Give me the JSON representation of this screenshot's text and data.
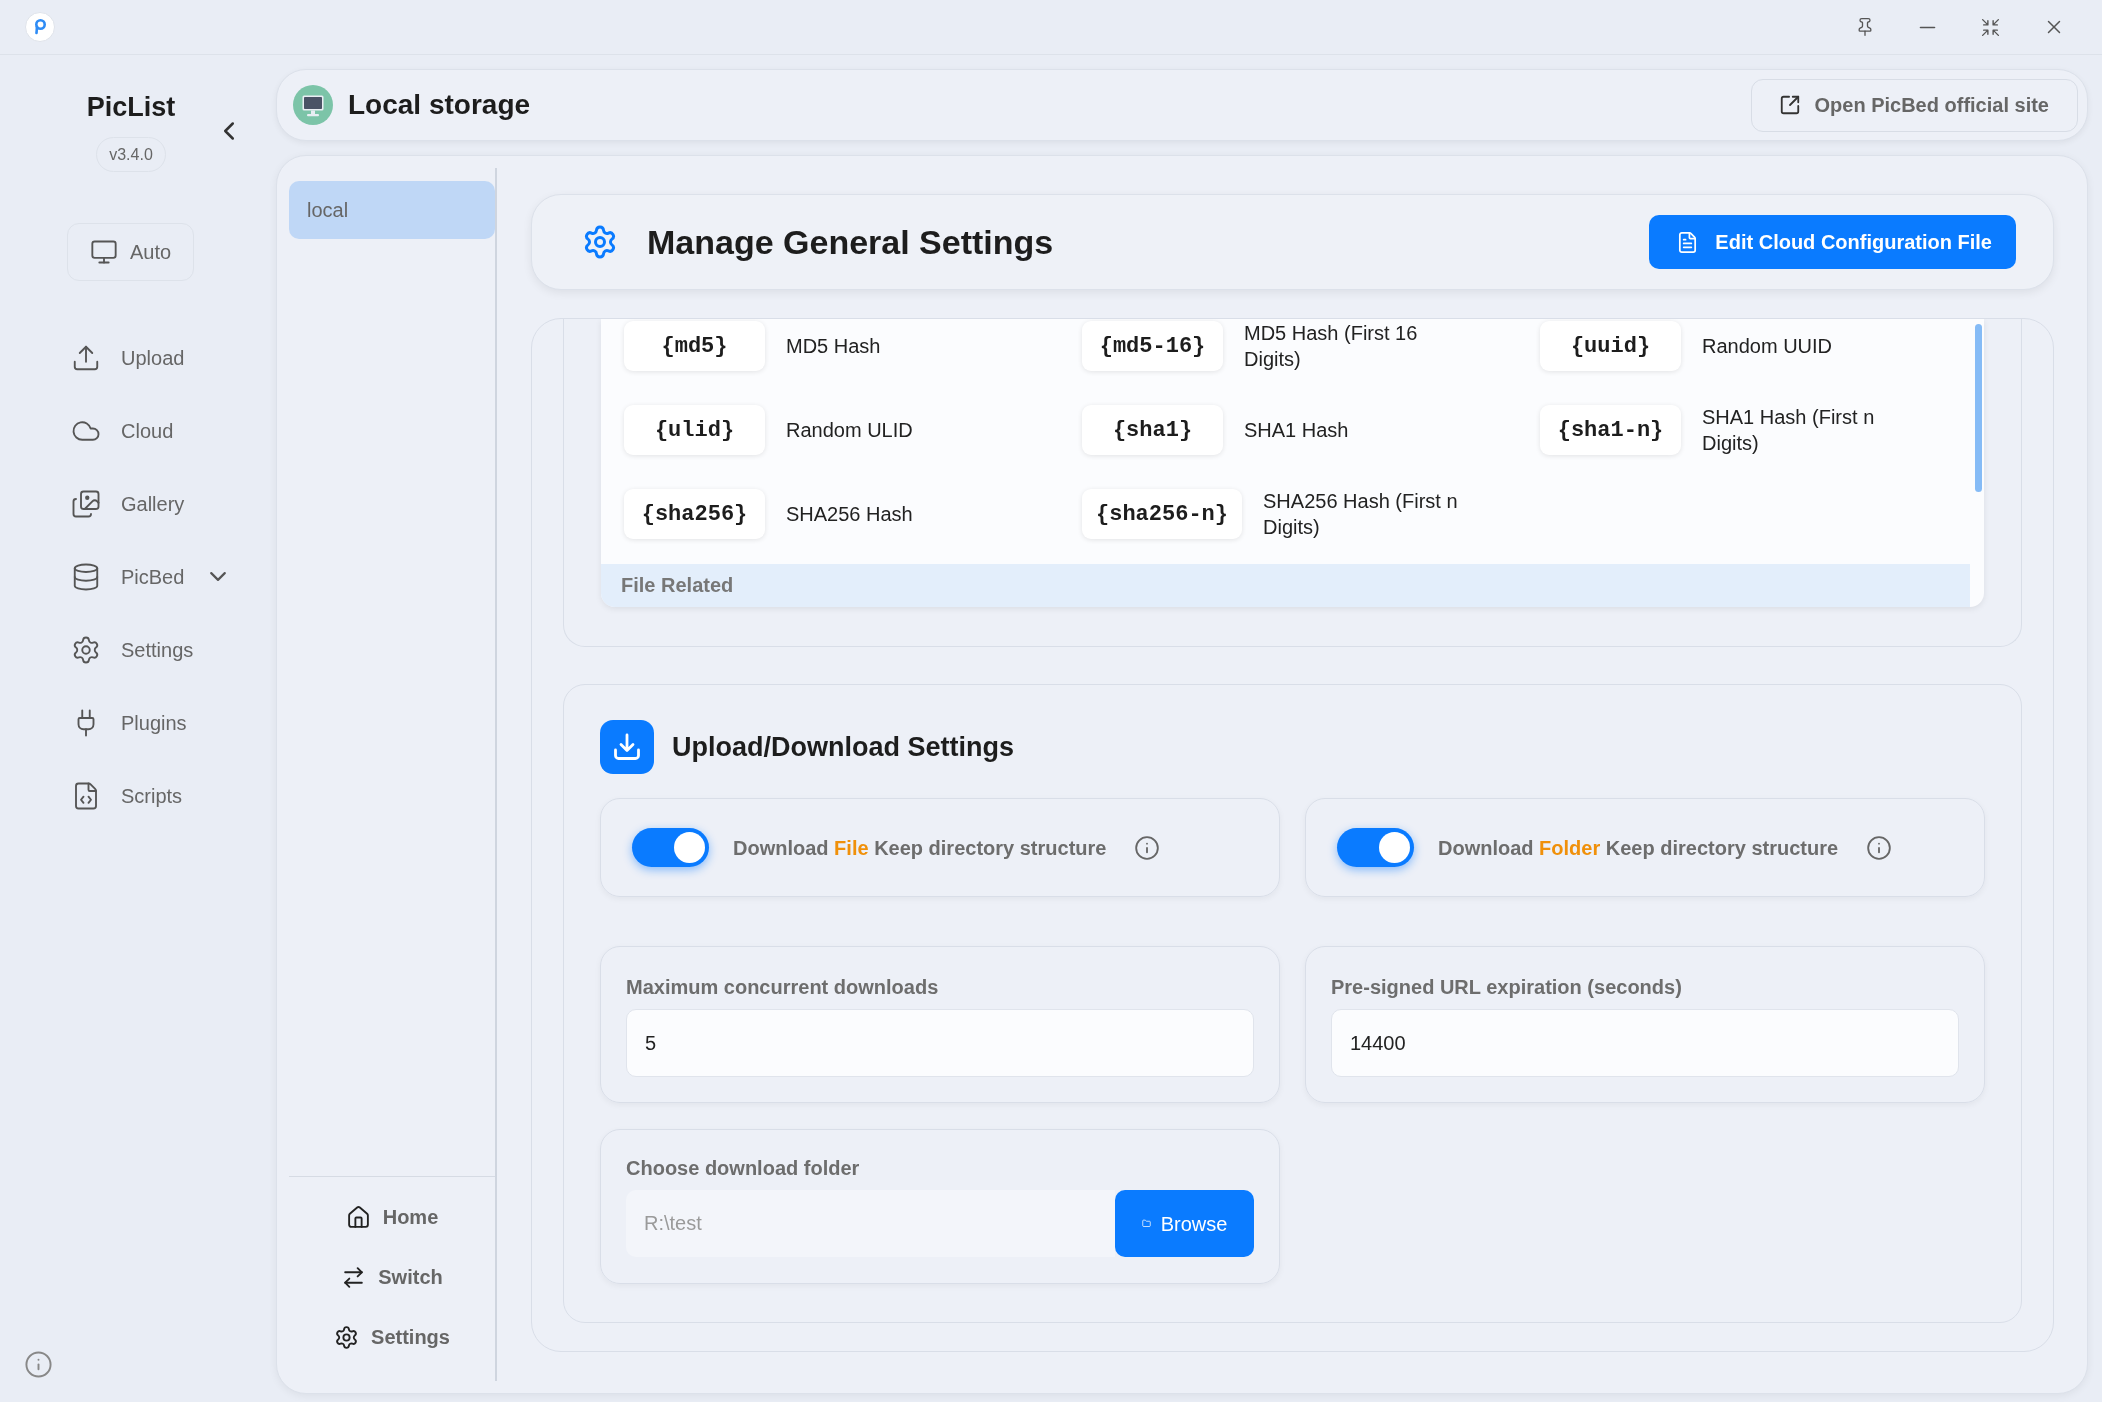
{
  "sidebar": {
    "app_name": "PicList",
    "version": "v3.4.0",
    "theme_button": {
      "label": "Auto"
    },
    "nav_items": [
      {
        "label": "Upload",
        "kind": "link"
      },
      {
        "label": "Cloud",
        "kind": "link"
      },
      {
        "label": "Gallery",
        "kind": "link"
      },
      {
        "label": "PicBed",
        "kind": "submenu"
      },
      {
        "label": "Settings",
        "kind": "link"
      },
      {
        "label": "Plugins",
        "kind": "link"
      },
      {
        "label": "Scripts",
        "kind": "link"
      }
    ]
  },
  "header": {
    "title": "Local storage",
    "site_button": "Open PicBed official site"
  },
  "storage_list": {
    "items": [
      {
        "label": "local",
        "selected": true
      }
    ],
    "footer_items": [
      {
        "label": "Home"
      },
      {
        "label": "Switch"
      },
      {
        "label": "Settings"
      }
    ]
  },
  "general_settings": {
    "title": "Manage General Settings",
    "edit_button": "Edit Cloud Configuration File"
  },
  "variables_table": {
    "items": [
      {
        "token": "{md5}",
        "description": "MD5 Hash"
      },
      {
        "token": "{md5-16}",
        "description": "MD5 Hash (First 16 Digits)"
      },
      {
        "token": "{uuid}",
        "description": "Random UUID"
      },
      {
        "token": "{ulid}",
        "description": "Random ULID"
      },
      {
        "token": "{sha1}",
        "description": "SHA1 Hash"
      },
      {
        "token": "{sha1-n}",
        "description": "SHA1 Hash (First n Digits)"
      },
      {
        "token": "{sha256}",
        "description": "SHA256 Hash"
      },
      {
        "token": "{sha256-n}",
        "description": "SHA256 Hash (First n Digits)"
      }
    ],
    "section_heading": "File Related"
  },
  "upload_download": {
    "title": "Upload/Download Settings",
    "toggles": [
      {
        "label_start": "Download",
        "highlight": "File",
        "label_end": "Keep directory structure",
        "on": true
      },
      {
        "label_start": "Download",
        "highlight": "Folder",
        "label_end": "Keep directory structure",
        "on": true
      }
    ],
    "fields": [
      {
        "label": "Maximum concurrent downloads",
        "value": "5"
      },
      {
        "label": "Pre-signed URL expiration (seconds)",
        "value": "14400"
      }
    ],
    "folder_field": {
      "label": "Choose download folder",
      "value": "R:\\test",
      "disabled": true,
      "button": "Browse"
    }
  }
}
